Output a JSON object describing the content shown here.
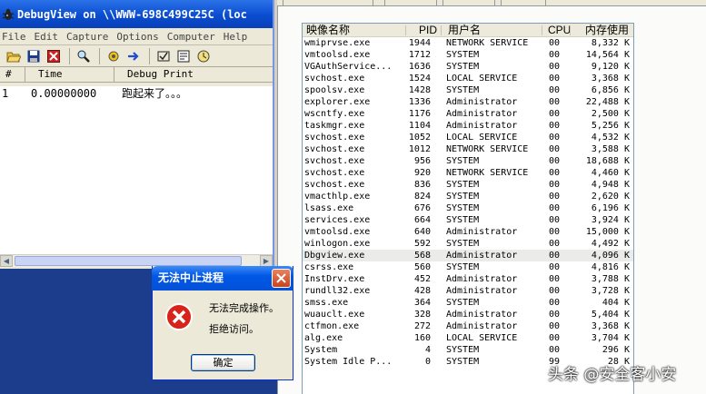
{
  "debugview": {
    "title": "DebugView on \\\\WWW-698C499C25C (loc",
    "menu": [
      "File",
      "Edit",
      "Capture",
      "Options",
      "Computer",
      "Help"
    ],
    "toolbar_icons": [
      "open-folder-icon",
      "save-icon",
      "clear-icon",
      "find-icon",
      "capture-icon",
      "autoscroll-icon",
      "highlight-icon",
      "filter-icon",
      "clock-icon"
    ],
    "columns": {
      "num": "#",
      "time": "Time",
      "debug_print": "Debug Print"
    },
    "rows": [
      {
        "num": "1",
        "time": "0.00000000",
        "text": "跑起来了。。。"
      }
    ]
  },
  "taskmgr": {
    "columns": {
      "name": "映像名称",
      "pid": "PID",
      "user": "用户名",
      "cpu": "CPU",
      "mem": "内存使用"
    },
    "processes": [
      {
        "name": "wmiprvse.exe",
        "pid": "1944",
        "user": "NETWORK SERVICE",
        "cpu": "00",
        "mem": "8,332 K"
      },
      {
        "name": "vmtoolsd.exe",
        "pid": "1712",
        "user": "SYSTEM",
        "cpu": "00",
        "mem": "14,564 K"
      },
      {
        "name": "VGAuthService...",
        "pid": "1636",
        "user": "SYSTEM",
        "cpu": "00",
        "mem": "9,120 K"
      },
      {
        "name": "svchost.exe",
        "pid": "1524",
        "user": "LOCAL SERVICE",
        "cpu": "00",
        "mem": "3,368 K"
      },
      {
        "name": "spoolsv.exe",
        "pid": "1428",
        "user": "SYSTEM",
        "cpu": "00",
        "mem": "6,856 K"
      },
      {
        "name": "explorer.exe",
        "pid": "1336",
        "user": "Administrator",
        "cpu": "00",
        "mem": "22,488 K"
      },
      {
        "name": "wscntfy.exe",
        "pid": "1176",
        "user": "Administrator",
        "cpu": "00",
        "mem": "2,500 K"
      },
      {
        "name": "taskmgr.exe",
        "pid": "1104",
        "user": "Administrator",
        "cpu": "00",
        "mem": "5,256 K"
      },
      {
        "name": "svchost.exe",
        "pid": "1052",
        "user": "LOCAL SERVICE",
        "cpu": "00",
        "mem": "4,532 K"
      },
      {
        "name": "svchost.exe",
        "pid": "1012",
        "user": "NETWORK SERVICE",
        "cpu": "00",
        "mem": "3,588 K"
      },
      {
        "name": "svchost.exe",
        "pid": "956",
        "user": "SYSTEM",
        "cpu": "00",
        "mem": "18,688 K"
      },
      {
        "name": "svchost.exe",
        "pid": "920",
        "user": "NETWORK SERVICE",
        "cpu": "00",
        "mem": "4,460 K"
      },
      {
        "name": "svchost.exe",
        "pid": "836",
        "user": "SYSTEM",
        "cpu": "00",
        "mem": "4,948 K"
      },
      {
        "name": "vmacthlp.exe",
        "pid": "824",
        "user": "SYSTEM",
        "cpu": "00",
        "mem": "2,620 K"
      },
      {
        "name": "lsass.exe",
        "pid": "676",
        "user": "SYSTEM",
        "cpu": "00",
        "mem": "6,196 K"
      },
      {
        "name": "services.exe",
        "pid": "664",
        "user": "SYSTEM",
        "cpu": "00",
        "mem": "3,924 K"
      },
      {
        "name": "vmtoolsd.exe",
        "pid": "640",
        "user": "Administrator",
        "cpu": "00",
        "mem": "15,000 K"
      },
      {
        "name": "winlogon.exe",
        "pid": "592",
        "user": "SYSTEM",
        "cpu": "00",
        "mem": "4,492 K"
      },
      {
        "name": "Dbgview.exe",
        "pid": "568",
        "user": "Administrator",
        "cpu": "00",
        "mem": "4,096 K",
        "selected": true
      },
      {
        "name": "csrss.exe",
        "pid": "560",
        "user": "SYSTEM",
        "cpu": "00",
        "mem": "4,816 K"
      },
      {
        "name": "InstDrv.exe",
        "pid": "452",
        "user": "Administrator",
        "cpu": "00",
        "mem": "3,788 K"
      },
      {
        "name": "rundll32.exe",
        "pid": "428",
        "user": "Administrator",
        "cpu": "00",
        "mem": "3,728 K"
      },
      {
        "name": "smss.exe",
        "pid": "364",
        "user": "SYSTEM",
        "cpu": "00",
        "mem": "404 K"
      },
      {
        "name": "wuauclt.exe",
        "pid": "328",
        "user": "Administrator",
        "cpu": "00",
        "mem": "5,404 K"
      },
      {
        "name": "ctfmon.exe",
        "pid": "272",
        "user": "Administrator",
        "cpu": "00",
        "mem": "3,368 K"
      },
      {
        "name": "alg.exe",
        "pid": "160",
        "user": "LOCAL SERVICE",
        "cpu": "00",
        "mem": "3,704 K"
      },
      {
        "name": "System",
        "pid": "4",
        "user": "SYSTEM",
        "cpu": "00",
        "mem": "296 K"
      },
      {
        "name": "System Idle P...",
        "pid": "0",
        "user": "SYSTEM",
        "cpu": "99",
        "mem": "28 K"
      }
    ]
  },
  "dialog": {
    "title": "无法中止进程",
    "message_line1": "无法完成操作。",
    "message_line2": "拒绝访问。",
    "ok_label": "确定"
  },
  "watermark": {
    "text": "头条 @安全客小安"
  }
}
